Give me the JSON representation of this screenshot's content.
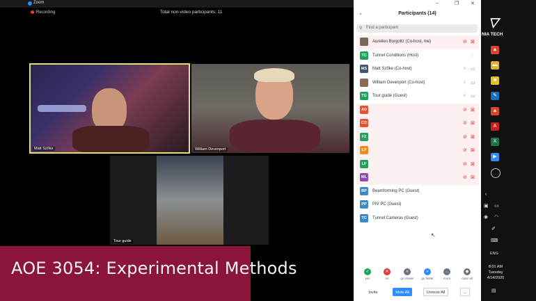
{
  "window": {
    "title": "Zoom",
    "controls": [
      "–",
      "❐",
      "✕"
    ]
  },
  "recording": "Recording",
  "total_nonvideo": "Total non-video participants: 11",
  "videos": [
    {
      "name": "Matt Szőke"
    },
    {
      "name": "William Devenport"
    },
    {
      "name": "Tour guide"
    }
  ],
  "banner": "AOE 3054: Experimental Methods",
  "panel": {
    "title": "Participants (14)",
    "search_placeholder": "Find a participant",
    "participants": [
      {
        "initials": "",
        "name": "Aurelien Borgoltz (Co-host, me)",
        "color": "#7b6a5a",
        "mic": "muted",
        "cam": "off"
      },
      {
        "initials": "TC",
        "name": "Tunnel Conditions (Host)",
        "color": "#21a35a",
        "mic": "none",
        "cam": "circle"
      },
      {
        "initials": "MS",
        "name": "Matt Szőke (Co-host)",
        "color": "#3f5670",
        "mic": "on",
        "cam": "on"
      },
      {
        "initials": "",
        "name": "William Devenport (Co-host)",
        "color": "#8b6a55",
        "mic": "on",
        "cam": "on"
      },
      {
        "initials": "TG",
        "name": "Tour guide (Guest)",
        "color": "#21a35a",
        "mic": "on",
        "cam": "on"
      },
      {
        "initials": "AD",
        "name": "",
        "color": "#e8502f",
        "mic": "muted",
        "cam": "off"
      },
      {
        "initials": "CO",
        "name": "",
        "color": "#e8502f",
        "mic": "muted",
        "cam": "off"
      },
      {
        "initials": "FZ",
        "name": "",
        "color": "#21a35a",
        "mic": "muted",
        "cam": "off"
      },
      {
        "initials": "LP",
        "name": "",
        "color": "#f28a1d",
        "mic": "muted",
        "cam": "off"
      },
      {
        "initials": "LF",
        "name": "",
        "color": "#21a35a",
        "mic": "muted",
        "cam": "off"
      },
      {
        "initials": "ML",
        "name": "",
        "color": "#8f4bb5",
        "mic": "muted",
        "cam": "off"
      },
      {
        "initials": "BP",
        "name": "Beamforming PC (Guest)",
        "color": "#3f8ac6",
        "mic": "none",
        "cam": "none"
      },
      {
        "initials": "PP",
        "name": "PIV PC (Guest)",
        "color": "#3f8ac6",
        "mic": "none",
        "cam": "none"
      },
      {
        "initials": "TC",
        "name": "Tunnel Cameras (Guest)",
        "color": "#3f8ac6",
        "mic": "none",
        "cam": "none"
      }
    ],
    "controls": [
      {
        "label": "yes",
        "glyph": "✓",
        "color": "#21a35a"
      },
      {
        "label": "no",
        "glyph": "✕",
        "color": "#e53935"
      },
      {
        "label": "go slower",
        "glyph": "«",
        "color": "#6b7280"
      },
      {
        "label": "go faster",
        "glyph": "»",
        "color": "#2d8cff"
      },
      {
        "label": "more",
        "glyph": "…",
        "color": "#6b7280"
      },
      {
        "label": "clear all",
        "glyph": "◆",
        "color": "#6b7280"
      }
    ],
    "buttons": {
      "invite": "Invite",
      "mute_all": "Mute All",
      "unmute_all": "Unmute All",
      "more": "..."
    }
  },
  "taskbar": {
    "logo_text": "NIA TECH",
    "language": "ENG",
    "time": "8:01 AM",
    "day": "Tuesday",
    "date": "4/14/2020"
  },
  "colors": {
    "accent": "#2d8cff",
    "banner": "#8a1538",
    "active_speaker": "#e2e26d"
  }
}
